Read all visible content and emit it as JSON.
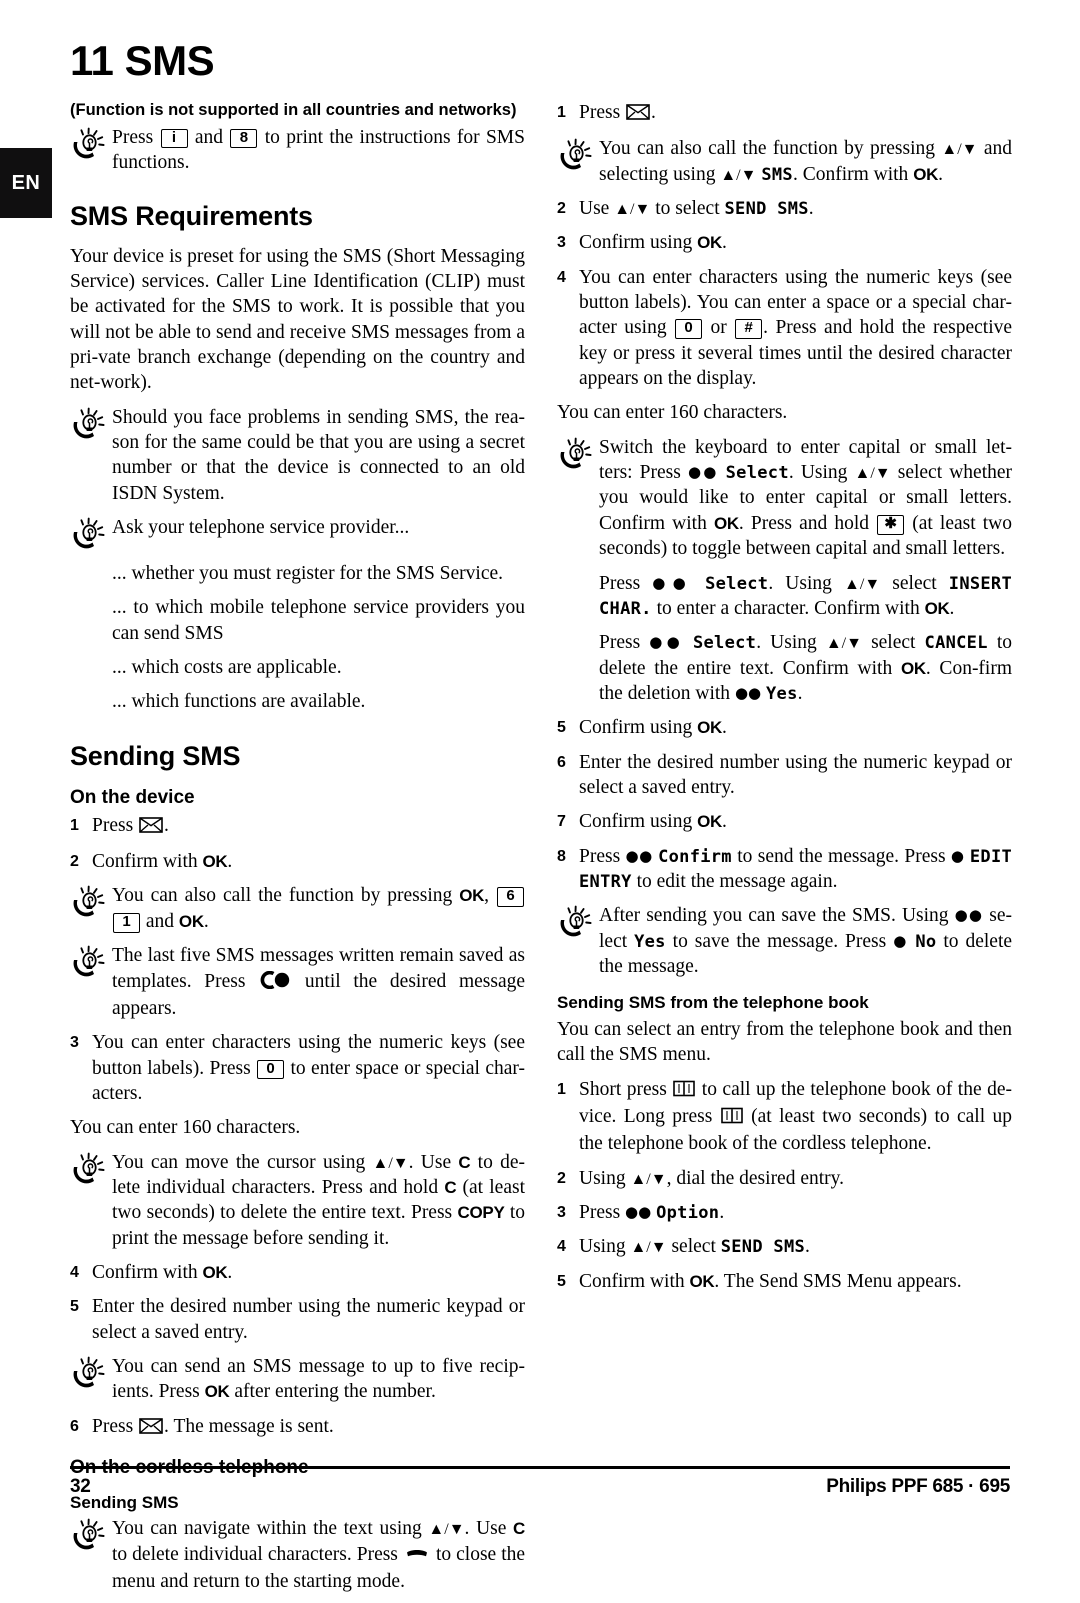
{
  "page": {
    "language_tab": "EN",
    "chapter_title": "11 SMS",
    "footer_page_number": "32",
    "footer_model": "Philips PPF 685 · 695"
  },
  "left_column": {
    "note_bold": "(Function is not supported in all countries and networks)",
    "tip_print": {
      "before": "Press",
      "key1": "i",
      "middle": "and",
      "key2": "8",
      "after": "to print the instructions for SMS functions."
    },
    "section_requirements": {
      "heading": "SMS Requirements",
      "intro": "Your device is preset for using the SMS (Short Messaging Service) services. Caller Line Identification (CLIP) must be activated for the SMS to work. It is possible that you will not be able to send and receive SMS messages from a pri-vate branch exchange (depending on the country and net-work).",
      "tip_problems": "Should you face problems in sending SMS, the rea-son for the same could be that you are using a secret number or that the device is connected to an old ISDN System.",
      "tip_ask": "Ask your telephone service provider...",
      "bullets": [
        "... whether you must register for the SMS Service.",
        "... to which mobile telephone service providers you can send SMS",
        "... which costs are applicable.",
        "... which functions are available."
      ]
    },
    "section_sending": {
      "heading": "Sending SMS",
      "sub_device": "On the device",
      "step1": {
        "num": "1",
        "before": "Press",
        "icon": "envelope-icon",
        "after": "."
      },
      "step2": {
        "num": "2",
        "text_before": "Confirm with",
        "key": "OK",
        "text_after": "."
      },
      "tip_call_function": {
        "part1": "You can also call the function by pressing",
        "key_ok1": "OK",
        "comma": ",",
        "key_6": "6",
        "key_1": "1",
        "and": "and",
        "key_ok2": "OK",
        "end": "."
      },
      "tip_templates": {
        "part1": "The last five SMS messages written remain saved as templates. Press",
        "icon": "c-dot-icon",
        "part2": "until the desired message appears."
      },
      "step3": {
        "num": "3",
        "part1": "You can enter characters using the numeric keys (see button labels). Press",
        "key_0": "0",
        "part2": "to enter space or special char-acters."
      },
      "note_160": "You can enter 160 characters.",
      "tip_cursor": {
        "part1": "You can move the cursor using",
        "arrows": "▲/▼",
        "part2": ". Use",
        "key_c1": "C",
        "part3": "to de-lete individual characters. Press and hold",
        "key_c2": "C",
        "part4": "(at least two seconds) to delete the entire text. Press",
        "key_copy": "COPY",
        "part5": "to print the message before sending it."
      },
      "step4": {
        "num": "4",
        "text_before": "Confirm with",
        "key": "OK",
        "text_after": "."
      },
      "step5": {
        "num": "5",
        "text": "Enter the desired number using the numeric keypad or select a saved entry."
      },
      "tip_recipients": {
        "part1": "You can send an SMS message to up to five recip-ients. Press",
        "key_ok": "OK",
        "part2": "after entering the number."
      },
      "step6": {
        "num": "6",
        "before": "Press",
        "icon": "envelope-icon",
        "after": ". The message is sent."
      },
      "sub_cordless": "On the cordless telephone",
      "sub_cordless_sending": "Sending SMS",
      "tip_navigate": {
        "part1": "You can navigate within the text using",
        "arrows": "▲/▼",
        "part2": ". Use",
        "key_c": "C",
        "part3": "to delete individual characters. Press",
        "icon": "hangup-icon",
        "part4": "to close the menu and return to the starting mode."
      }
    }
  },
  "right_column": {
    "step1": {
      "num": "1",
      "before": "Press",
      "icon": "envelope-icon",
      "after": "."
    },
    "tip_call_function": {
      "part1": "You can also call the function by pressing",
      "arrows1": "▲/▼",
      "part2": "and selecting using",
      "arrows2": "▲/▼",
      "lcd_sms": "SMS",
      "part3": ". Confirm with",
      "key_ok": "OK",
      "part4": "."
    },
    "step2": {
      "num": "2",
      "part1": "Use",
      "arrows": "▲/▼",
      "part2": "to select",
      "lcd": "SEND SMS",
      "part3": "."
    },
    "step3": {
      "num": "3",
      "text_before": "Confirm using",
      "key": "OK",
      "text_after": "."
    },
    "step4": {
      "num": "4",
      "part1": "You can enter characters using the numeric keys (see button labels). You can enter a space or a special char-acter using",
      "key_0": "0",
      "or": "or",
      "key_hash": "#",
      "part2": ". Press and hold the respective key or press it several times until the desired character appears on the display."
    },
    "note_160": "You can enter 160 characters.",
    "tip_switch_keyboard": {
      "part1": "Switch the keyboard to enter capital or small let-ters: Press",
      "dots2a": "●●",
      "lcd_select": "Select",
      "part2": ". Using",
      "arrows": "▲/▼",
      "part3": "select whether you would like to enter capital or small letters. Confirm with",
      "key_ok": "OK",
      "part4": ". Press and hold",
      "key_star": "✱",
      "part5": "(at least two seconds) to toggle between capital and small letters."
    },
    "tip_insert_char": {
      "part1": "Press",
      "dots": "●●",
      "lcd_select": "Select",
      "part2": ". Using",
      "arrows": "▲/▼",
      "part3": "select",
      "lcd_insert": "INSERT CHAR.",
      "part4": "to enter a character. Confirm with",
      "key_ok": "OK",
      "part5": "."
    },
    "tip_cancel": {
      "part1": "Press",
      "dots": "●●",
      "lcd_select": "Select",
      "part2": ". Using",
      "arrows": "▲/▼",
      "part3": "select",
      "lcd_cancel": "CANCEL",
      "part4": "to delete the entire text. Confirm with",
      "key_ok": "OK",
      "part5": ". Con-firm the deletion with",
      "dots2": "●●",
      "lcd_yes": "Yes",
      "part6": "."
    },
    "step5": {
      "num": "5",
      "text_before": "Confirm using",
      "key": "OK",
      "text_after": "."
    },
    "step6": {
      "num": "6",
      "text": "Enter the desired number using the numeric keypad or select a saved entry."
    },
    "step7": {
      "num": "7",
      "text_before": "Confirm using",
      "key": "OK",
      "text_after": "."
    },
    "step8": {
      "num": "8",
      "part1": "Press",
      "dots2": "●●",
      "lcd_confirm": "Confirm",
      "part2": "to send the message. Press",
      "dot1": "●",
      "lcd_edit": "EDIT ENTRY",
      "part3": "to edit the message again."
    },
    "tip_after_sending": {
      "part1": "After sending you can save the SMS. Using",
      "dots2": "●●",
      "part2": "se-lect",
      "lcd_yes": "Yes",
      "part3": "to save the message. Press",
      "dot1": "●",
      "lcd_no": "No",
      "part4": "to delete the message."
    },
    "section_phonebook": {
      "heading": "Sending SMS from the telephone book",
      "intro": "You can select an entry from the telephone book and then call the SMS menu.",
      "step1": {
        "num": "1",
        "part1": "Short press",
        "icon1": "phonebook-icon",
        "part2": "to call up the telephone book of the de-vice. Long press",
        "icon2": "phonebook-icon",
        "part3": "(at least two seconds) to call up the telephone book of the cordless telephone."
      },
      "step2": {
        "num": "2",
        "part1": "Using",
        "arrows": "▲/▼",
        "part2": ", dial the desired entry."
      },
      "step3": {
        "num": "3",
        "part1": "Press",
        "dots": "●●",
        "lcd": "Option",
        "part2": "."
      },
      "step4": {
        "num": "4",
        "part1": "Using",
        "arrows": "▲/▼",
        "part2": "select",
        "lcd": "SEND SMS",
        "part3": "."
      },
      "step5": {
        "num": "5",
        "text_before": "Confirm with",
        "key": "OK",
        "text_after": ". The Send SMS Menu appears."
      }
    }
  }
}
